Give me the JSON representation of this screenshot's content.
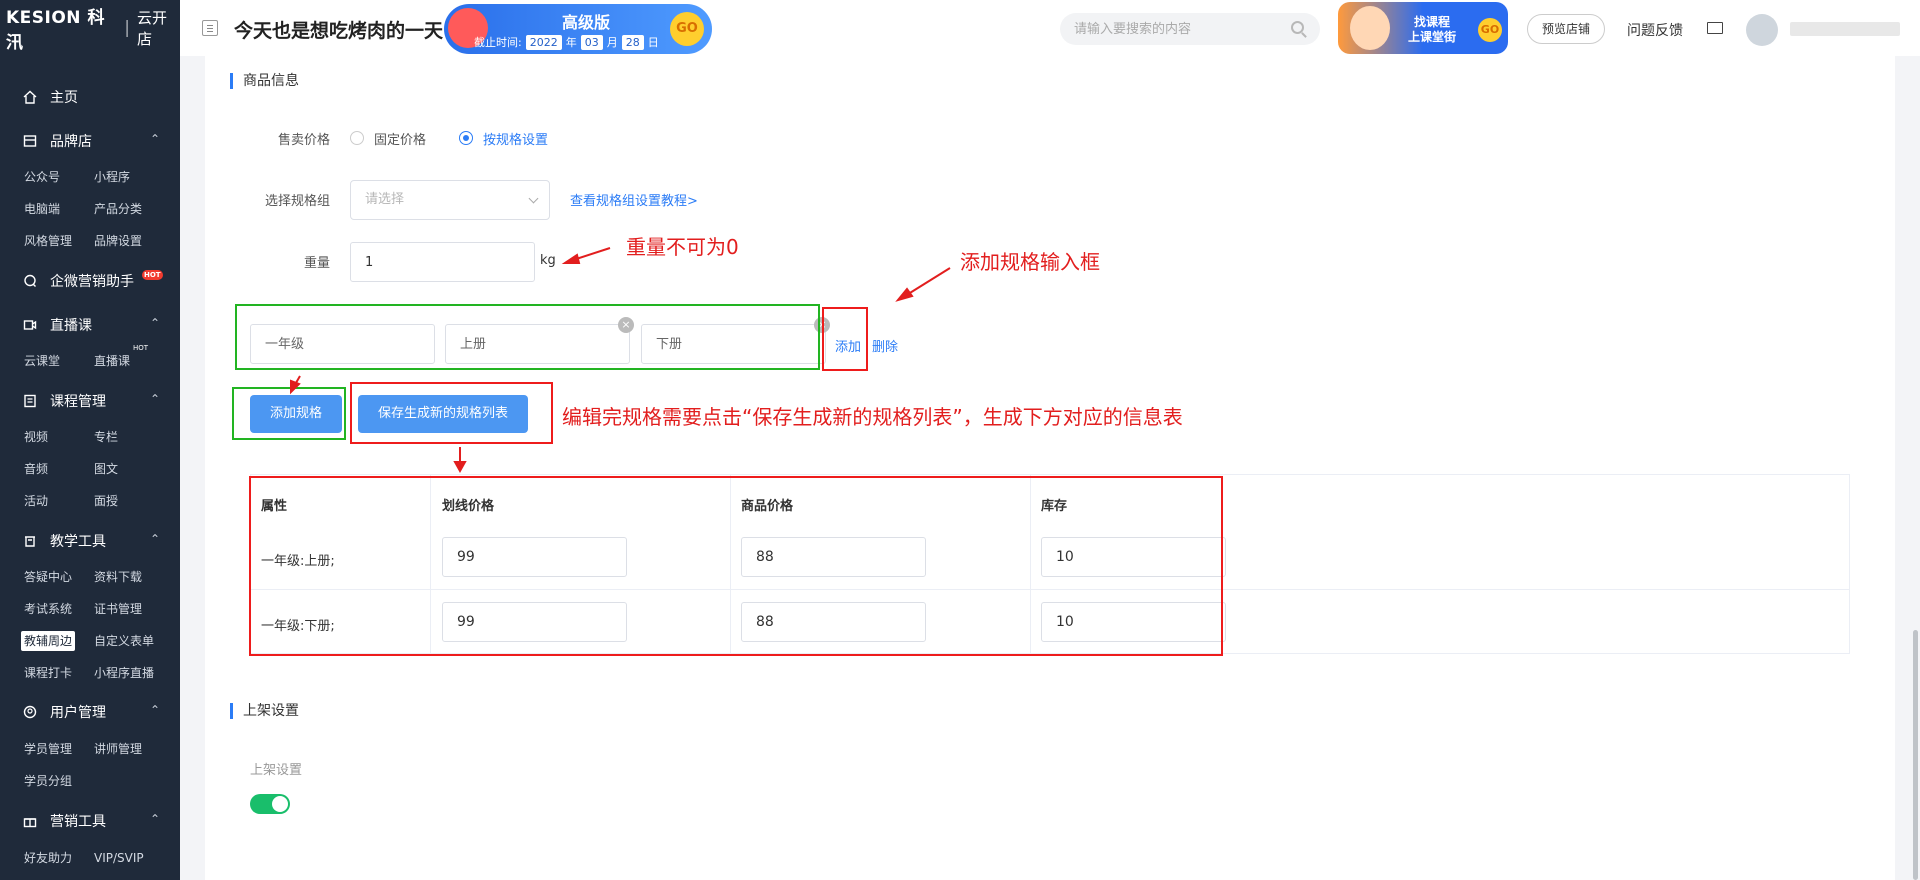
{
  "brand": {
    "logo": "KESION 科汛",
    "product": "云开店"
  },
  "sidebar": {
    "home": "主页",
    "sections": [
      {
        "label": "品牌店",
        "items": [
          "公众号",
          "小程序",
          "电脑端",
          "产品分类",
          "风格管理",
          "品牌设置"
        ]
      },
      {
        "label": "企微营销助手",
        "badge": "HOT"
      },
      {
        "label": "直播课",
        "items": [
          "云课堂",
          "直播课"
        ],
        "item_badge": "HOT"
      },
      {
        "label": "课程管理",
        "items": [
          "视频",
          "专栏",
          "音频",
          "图文",
          "活动",
          "面授"
        ]
      },
      {
        "label": "教学工具",
        "items": [
          "答疑中心",
          "资料下载",
          "考试系统",
          "证书管理",
          "教辅周边",
          "自定义表单",
          "课程打卡",
          "小程序直播"
        ],
        "active": "教辅周边"
      },
      {
        "label": "用户管理",
        "items": [
          "学员管理",
          "讲师管理",
          "学员分组"
        ]
      },
      {
        "label": "营销工具",
        "items": [
          "好友助力",
          "VIP/SVIP"
        ]
      }
    ]
  },
  "topbar": {
    "shop_name": "今天也是想吃烤肉的一天",
    "version_banner": {
      "version": "高级版",
      "expiry_label": "截止时间:",
      "year": "2022",
      "year_unit": "年",
      "month": "03",
      "month_unit": "月",
      "day": "28",
      "day_unit": "日",
      "go": "GO"
    },
    "search_placeholder": "请输入要搜索的内容",
    "promo": {
      "line1": "找课程",
      "line2": "上课堂街",
      "go": "GO"
    },
    "preview_store": "预览店铺",
    "feedback": "问题反馈"
  },
  "product_info": {
    "section_title": "商品信息",
    "price_label": "售卖价格",
    "price_options": [
      "固定价格",
      "按规格设置"
    ],
    "price_selected": "按规格设置",
    "spec_group_label": "选择规格组",
    "spec_group_placeholder": "请选择",
    "spec_tutorial_link": "查看规格组设置教程>",
    "weight_label": "重量",
    "weight_value": "1",
    "weight_unit": "kg",
    "spec_inputs": [
      "一年级",
      "上册",
      "下册"
    ],
    "spec_add": "添加",
    "spec_delete": "删除",
    "add_spec_button": "添加规格",
    "save_spec_button": "保存生成新的规格列表"
  },
  "annotations": {
    "weight_note": "重量不可为0",
    "spec_input_note": "添加规格输入框",
    "save_note": "编辑完规格需要点击“保存生成新的规格列表”，生成下方对应的信息表"
  },
  "spec_table": {
    "headers": [
      "属性",
      "划线价格",
      "商品价格",
      "库存"
    ],
    "rows": [
      {
        "attr": "一年级:上册;",
        "list_price": "99",
        "price": "88",
        "stock": "10"
      },
      {
        "attr": "一年级:下册;",
        "list_price": "99",
        "price": "88",
        "stock": "10"
      }
    ]
  },
  "listing": {
    "section_title": "上架设置",
    "label": "上架设置",
    "enabled": true
  },
  "colors": {
    "accent": "#2b7cf6",
    "sidebar_bg": "#1f2a3a",
    "annotation_red": "#ee1c1c",
    "annotation_green": "#22b422",
    "toggle_on": "#19be6b"
  }
}
